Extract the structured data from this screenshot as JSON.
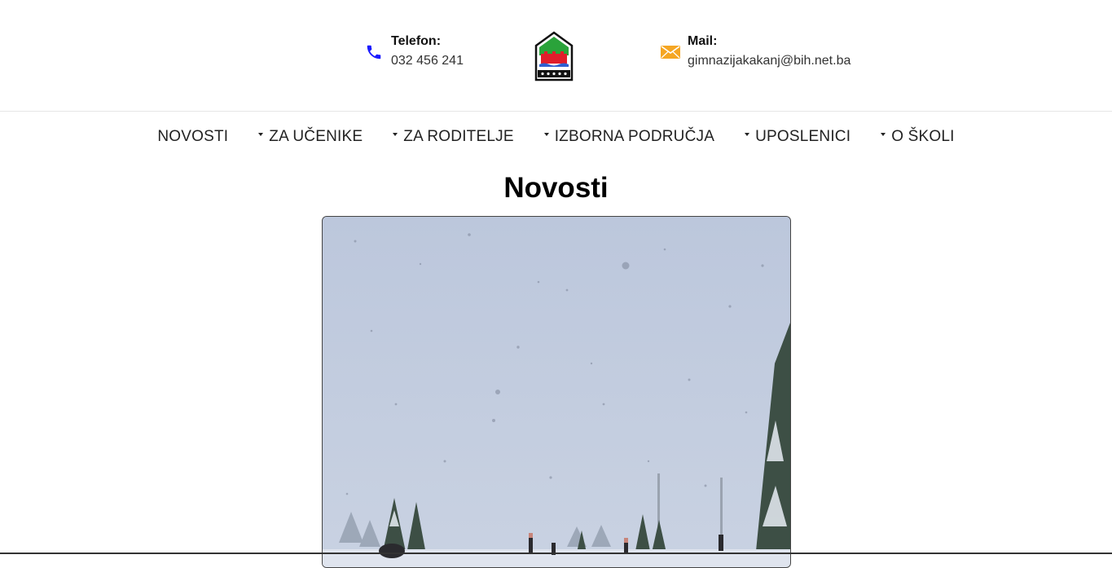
{
  "header": {
    "phone": {
      "label": "Telefon:",
      "value": "032 456 241",
      "icon": "phone-icon"
    },
    "mail": {
      "label": "Mail:",
      "value": "gimnazijakakanj@bih.net.ba",
      "icon": "envelope-icon"
    },
    "logo": "school-crest-logo"
  },
  "nav": {
    "items": [
      {
        "label": "NOVOSTI",
        "dropdown": false
      },
      {
        "label": "ZA UČENIKE",
        "dropdown": true
      },
      {
        "label": "ZA RODITELJE",
        "dropdown": true
      },
      {
        "label": "IZBORNA PODRUČJA",
        "dropdown": true
      },
      {
        "label": "UPOSLENICI",
        "dropdown": true
      },
      {
        "label": "O ŠKOLI",
        "dropdown": true
      }
    ]
  },
  "main": {
    "title": "Novosti"
  },
  "colors": {
    "phone_icon": "#1a1aff",
    "mail_icon": "#f5a623",
    "sky": "#c1cbde"
  }
}
